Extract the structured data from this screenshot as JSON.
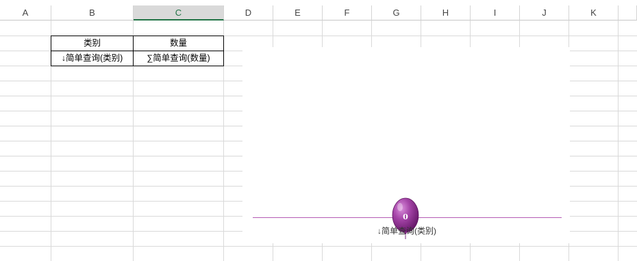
{
  "sheet": {
    "columns": [
      "A",
      "B",
      "C",
      "D",
      "E",
      "F",
      "G",
      "H",
      "I",
      "J",
      "K"
    ],
    "selected_column": "C"
  },
  "table": {
    "headers": [
      "类别",
      "数量"
    ],
    "row": [
      "↓简单查询(类别)",
      "∑简单查询(数量)"
    ]
  },
  "chart_data": {
    "type": "bar",
    "categories": [
      "↓简单查询(类别)"
    ],
    "values": [
      0
    ],
    "data_labels": [
      "0"
    ],
    "title": "",
    "xlabel": "",
    "ylabel": "",
    "marker": "balloon",
    "colors": {
      "marker": "#8b2a8f",
      "axis_line": "#b45ab4"
    }
  },
  "colors": {
    "grid": "#d9d9d9",
    "selected_header_bg": "#d9d9d9",
    "selected_header_text": "#217346"
  }
}
